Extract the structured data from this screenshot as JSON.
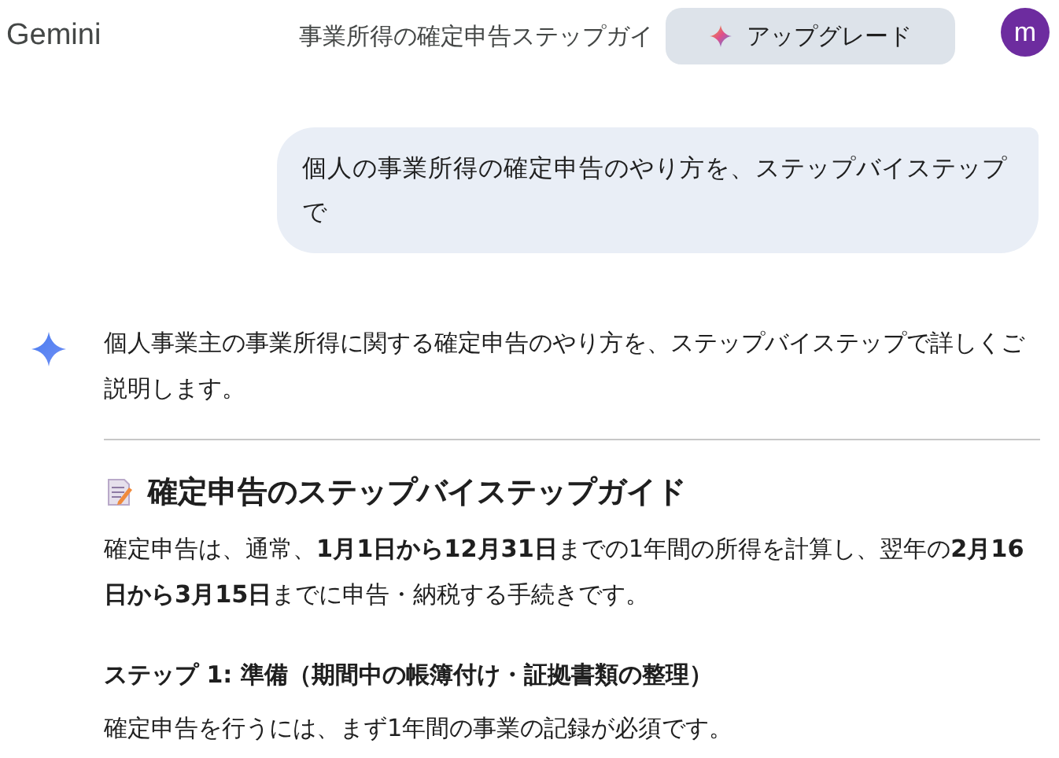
{
  "header": {
    "app_name": "Gemini",
    "conversation_title": "事業所得の確定申告ステップガイ",
    "upgrade_button": "アップグレード",
    "avatar_letter": "m"
  },
  "user_message": "個人の事業所得の確定申告のやり方を、ステップバイステップで",
  "reply": {
    "intro": "個人事業主の事業所得に関する確定申告のやり方を、ステップバイステップで詳しくご説明します。",
    "heading": "確定申告のステップバイステップガイド",
    "paragraph": "確定申告は、通常、**1月1日から12月31日**までの1年間の所得を計算し、翌年の**2月16日から3月15日**までに申告・納税する手続きです。",
    "step_heading": "ステップ 1: 準備（期間中の帳簿付け・証拠書類の整理）",
    "step_text": "確定申告を行うには、まず1年間の事業の記録が必須です。"
  }
}
